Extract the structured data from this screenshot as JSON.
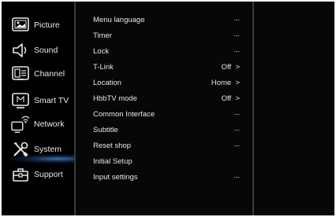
{
  "sidebar": {
    "items": [
      {
        "label": "Picture",
        "icon": "picture-icon"
      },
      {
        "label": "Sound",
        "icon": "speaker-icon"
      },
      {
        "label": "Channel",
        "icon": "channel-icon"
      },
      {
        "label": "Smart TV",
        "icon": "smart-tv-icon"
      },
      {
        "label": "Network",
        "icon": "network-icon"
      },
      {
        "label": "System",
        "icon": "tools-icon"
      },
      {
        "label": "Support",
        "icon": "toolbox-icon"
      }
    ],
    "selected": "System"
  },
  "menu": {
    "items": [
      {
        "label": "Menu language",
        "value": "..."
      },
      {
        "label": "Timer",
        "value": "..."
      },
      {
        "label": "Lock",
        "value": "..."
      },
      {
        "label": "T-Link",
        "value": "Off  >"
      },
      {
        "label": "Location",
        "value": "Home  >"
      },
      {
        "label": "HbbTV mode",
        "value": "Off  >"
      },
      {
        "label": "Common Interface",
        "value": "..."
      },
      {
        "label": "Subtitle",
        "value": "..."
      },
      {
        "label": "Reset shop",
        "value": "..."
      },
      {
        "label": "Initial Setup",
        "value": ""
      },
      {
        "label": "Input settings",
        "value": "..."
      }
    ]
  },
  "colors": {
    "background": "#050505",
    "text": "#e6e6e6",
    "highlight_glow": "#5096e6"
  }
}
